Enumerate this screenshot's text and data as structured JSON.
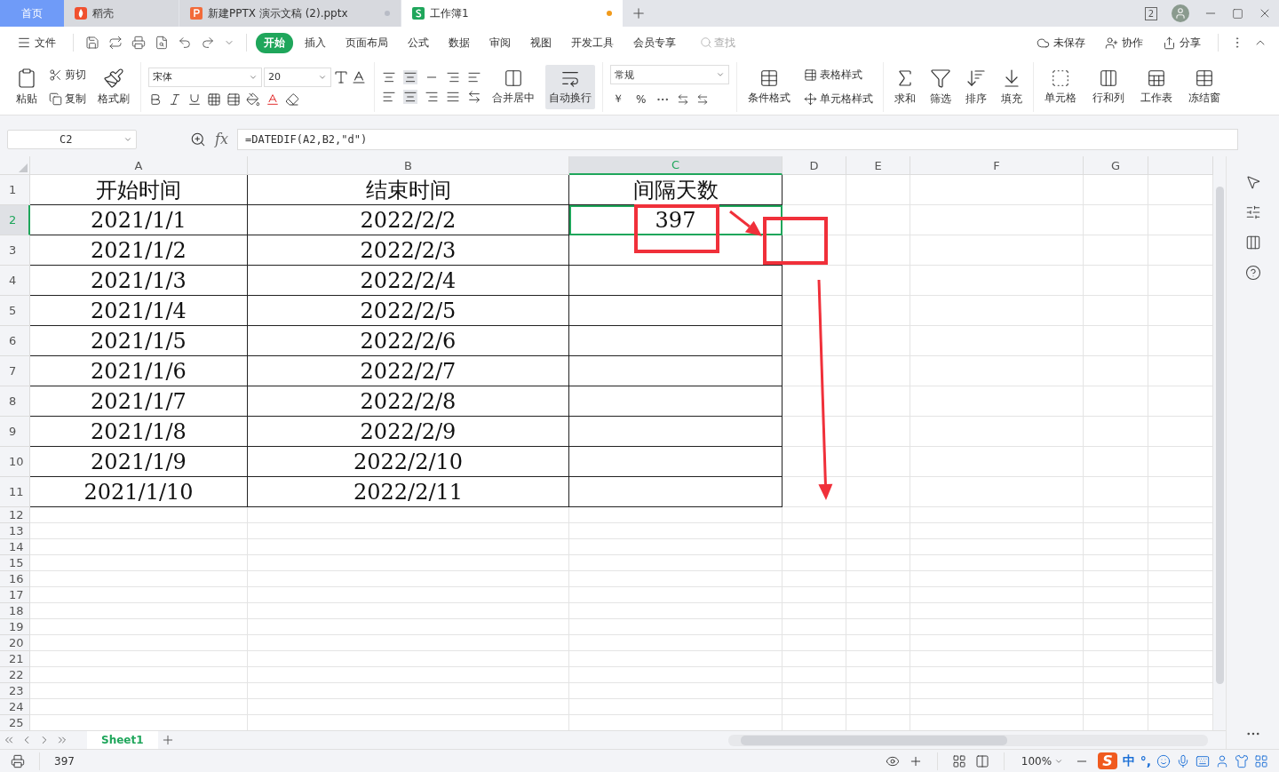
{
  "window_tabs": [
    {
      "label": "首页",
      "kind": "home",
      "selected": false
    },
    {
      "label": "稻壳",
      "kind": "docer",
      "selected": false
    },
    {
      "label": "新建PPTX 演示文稿 (2).pptx",
      "kind": "ppt",
      "selected": false
    },
    {
      "label": "工作簿1",
      "kind": "sheet",
      "selected": true
    }
  ],
  "window_badge": "2",
  "menu": {
    "file": "文件",
    "tabs": [
      {
        "label": "开始",
        "selected": true
      },
      {
        "label": "插入",
        "selected": false
      },
      {
        "label": "页面布局",
        "selected": false
      },
      {
        "label": "公式",
        "selected": false
      },
      {
        "label": "数据",
        "selected": false
      },
      {
        "label": "审阅",
        "selected": false
      },
      {
        "label": "视图",
        "selected": false
      },
      {
        "label": "开发工具",
        "selected": false
      },
      {
        "label": "会员专享",
        "selected": false
      }
    ],
    "search_placeholder": "查找",
    "actions": [
      "未保存",
      "协作",
      "分享"
    ]
  },
  "ribbon": {
    "clipboard": [
      "粘贴",
      "剪切",
      "复制",
      "格式刷"
    ],
    "font": {
      "name": "宋体",
      "size": "20"
    },
    "align": {
      "merge": "合并居中",
      "wrap": "自动换行",
      "wrap_on": true
    },
    "number": {
      "format": "常规",
      "currency": "￥",
      "percent": "%"
    },
    "styles": [
      "条件格式",
      "表格样式",
      "单元格样式"
    ],
    "edit": [
      "求和",
      "筛选",
      "排序",
      "填充"
    ],
    "cells": [
      "单元格",
      "行和列",
      "工作表",
      "冻结窗"
    ]
  },
  "name_box": "C2",
  "fx_label": "fx",
  "formula": "=DATEDIF(A2,B2,\"d\")",
  "columns": [
    {
      "label": "A",
      "selected": false
    },
    {
      "label": "B",
      "selected": false
    },
    {
      "label": "C",
      "selected": true
    },
    {
      "label": "D",
      "selected": false
    },
    {
      "label": "E",
      "selected": false
    },
    {
      "label": "F",
      "selected": false
    },
    {
      "label": "G",
      "selected": false
    }
  ],
  "rows": [
    {
      "number": "1",
      "selected": false,
      "cells": [
        {
          "text": "开始时间",
          "selected": false
        },
        {
          "text": "结束时间",
          "selected": false
        },
        {
          "text": "间隔天数",
          "selected": false
        }
      ]
    },
    {
      "number": "2",
      "selected": true,
      "cells": [
        {
          "text": "2021/1/1",
          "selected": false
        },
        {
          "text": "2022/2/2",
          "selected": false
        },
        {
          "text": "397",
          "selected": true
        }
      ]
    },
    {
      "number": "3",
      "selected": false,
      "cells": [
        {
          "text": "2021/1/2",
          "selected": false
        },
        {
          "text": "2022/2/3",
          "selected": false
        }
      ]
    },
    {
      "number": "4",
      "selected": false,
      "cells": [
        {
          "text": "2021/1/3",
          "selected": false
        },
        {
          "text": "2022/2/4",
          "selected": false
        }
      ]
    },
    {
      "number": "5",
      "selected": false,
      "cells": [
        {
          "text": "2021/1/4",
          "selected": false
        },
        {
          "text": "2022/2/5",
          "selected": false
        }
      ]
    },
    {
      "number": "6",
      "selected": false,
      "cells": [
        {
          "text": "2021/1/5",
          "selected": false
        },
        {
          "text": "2022/2/6",
          "selected": false
        }
      ]
    },
    {
      "number": "7",
      "selected": false,
      "cells": [
        {
          "text": "2021/1/6",
          "selected": false
        },
        {
          "text": "2022/2/7",
          "selected": false
        }
      ]
    },
    {
      "number": "8",
      "selected": false,
      "cells": [
        {
          "text": "2021/1/7",
          "selected": false
        },
        {
          "text": "2022/2/8",
          "selected": false
        }
      ]
    },
    {
      "number": "9",
      "selected": false,
      "cells": [
        {
          "text": "2021/1/8",
          "selected": false
        },
        {
          "text": "2022/2/9",
          "selected": false
        }
      ]
    },
    {
      "number": "10",
      "selected": false,
      "cells": [
        {
          "text": "2021/1/9",
          "selected": false
        },
        {
          "text": "2022/2/10",
          "selected": false
        }
      ]
    },
    {
      "number": "11",
      "selected": false,
      "cells": [
        {
          "text": "2021/1/10",
          "selected": false
        },
        {
          "text": "2022/2/11",
          "selected": false
        }
      ]
    },
    {
      "number": "12",
      "selected": false
    },
    {
      "number": "13",
      "selected": false
    },
    {
      "number": "14",
      "selected": false
    },
    {
      "number": "15",
      "selected": false
    },
    {
      "number": "16",
      "selected": false
    },
    {
      "number": "17",
      "selected": false
    },
    {
      "number": "18",
      "selected": false
    },
    {
      "number": "19",
      "selected": false
    },
    {
      "number": "20",
      "selected": false
    },
    {
      "number": "21",
      "selected": false
    },
    {
      "number": "22",
      "selected": false
    },
    {
      "number": "23",
      "selected": false
    },
    {
      "number": "24",
      "selected": false
    },
    {
      "number": "25",
      "selected": false
    }
  ],
  "annotations": [
    {
      "kind": "box"
    },
    {
      "kind": "box"
    },
    {
      "kind": "arrow"
    },
    {
      "kind": "arrow"
    }
  ],
  "sheet_tabs": [
    {
      "label": "Sheet1",
      "selected": true
    }
  ],
  "status": {
    "value": "397",
    "zoom": "100%"
  },
  "ime": {
    "logo": "S",
    "mode": "中",
    "punct": "°,"
  }
}
